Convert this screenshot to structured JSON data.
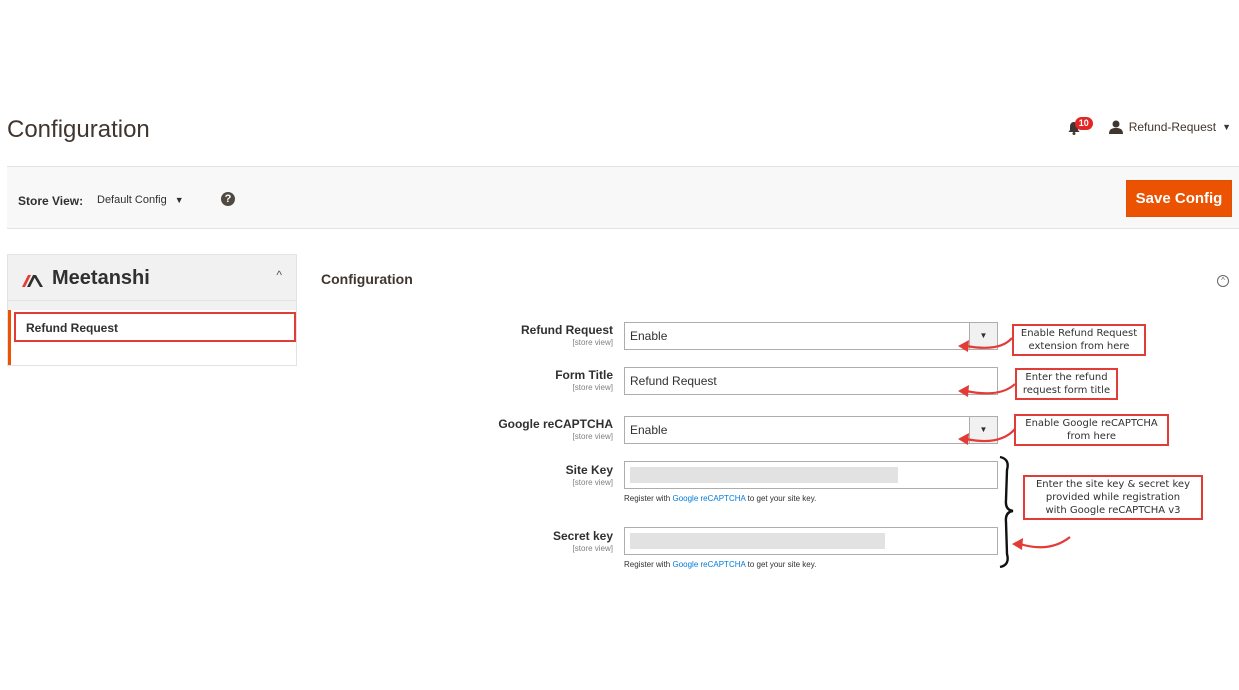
{
  "header": {
    "title": "Configuration",
    "notifications_count": "10",
    "user_name": "Refund-Request"
  },
  "store_bar": {
    "label": "Store View:",
    "selected": "Default Config",
    "help": "?",
    "save_label": "Save Config"
  },
  "sidebar": {
    "brand": "Meetanshi",
    "items": [
      {
        "label": "Refund Request"
      }
    ]
  },
  "section": {
    "title": "Configuration"
  },
  "fields": {
    "refund_request": {
      "label": "Refund Request",
      "scope": "[store view]",
      "value": "Enable"
    },
    "form_title": {
      "label": "Form Title",
      "scope": "[store view]",
      "value": "Refund Request"
    },
    "recaptcha": {
      "label": "Google reCAPTCHA",
      "scope": "[store view]",
      "value": "Enable"
    },
    "site_key": {
      "label": "Site Key",
      "scope": "[store view]",
      "note_prefix": "Register with ",
      "note_link": "Google reCAPTCHA",
      "note_suffix": " to get your site key."
    },
    "secret_key": {
      "label": "Secret key",
      "scope": "[store view]",
      "note_prefix": "Register with ",
      "note_link": "Google reCAPTCHA",
      "note_suffix": " to get your site key."
    }
  },
  "callouts": {
    "refund": [
      "Enable Refund Request",
      "extension from here"
    ],
    "title": [
      "Enter the refund",
      "request form title"
    ],
    "recaptcha": [
      "Enable Google reCAPTCHA",
      "from here"
    ],
    "keys": [
      "Enter the site key & secret key",
      "provided while registration",
      "with Google reCAPTCHA v3"
    ]
  },
  "colors": {
    "accent": "#eb5202",
    "callout_border": "#e33b36",
    "link": "#007bdb"
  }
}
